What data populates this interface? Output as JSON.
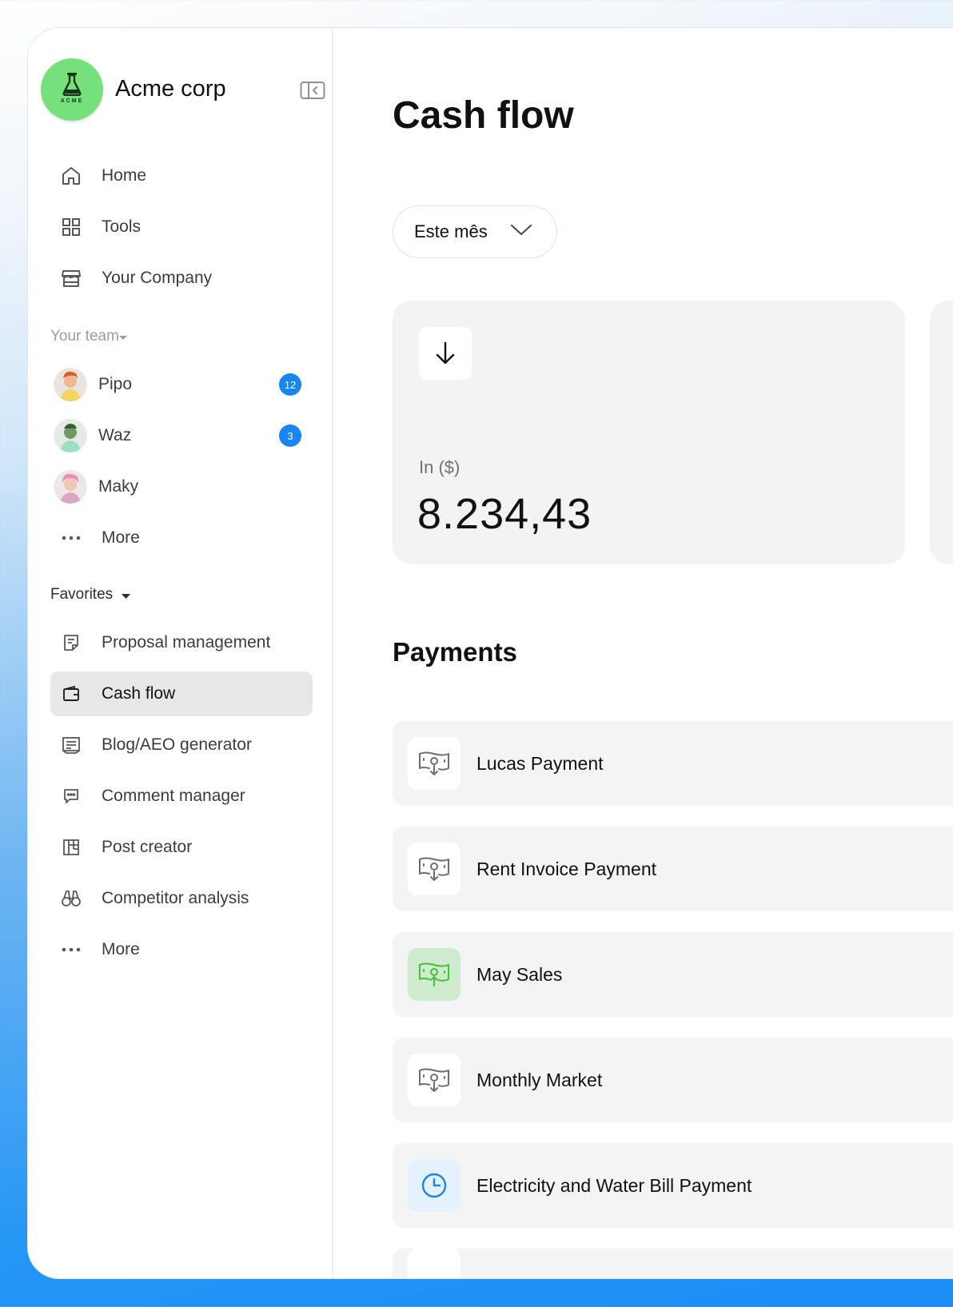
{
  "brand": {
    "name": "Acme corp",
    "logo_text": "ACME"
  },
  "nav": [
    {
      "label": "Home",
      "icon": "home-icon"
    },
    {
      "label": "Tools",
      "icon": "grid-icon"
    },
    {
      "label": "Your Company",
      "icon": "store-icon"
    }
  ],
  "team": {
    "label": "Your team",
    "members": [
      {
        "name": "Pipo",
        "badge": "12"
      },
      {
        "name": "Waz",
        "badge": "3"
      },
      {
        "name": "Maky",
        "badge": ""
      }
    ],
    "more_label": "More"
  },
  "favorites": {
    "label": "Favorites",
    "items": [
      {
        "label": "Proposal management",
        "icon": "document-icon"
      },
      {
        "label": "Cash flow",
        "icon": "wallet-icon",
        "active": true
      },
      {
        "label": "Blog/AEO generator",
        "icon": "article-icon"
      },
      {
        "label": "Comment manager",
        "icon": "comment-icon"
      },
      {
        "label": "Post creator",
        "icon": "layout-icon"
      },
      {
        "label": "Competitor analysis",
        "icon": "binoculars-icon"
      }
    ],
    "more_label": "More"
  },
  "main": {
    "title": "Cash flow",
    "period": {
      "selected": "Este mês"
    },
    "kpi": {
      "label": "In ($)",
      "value": "8.234,43"
    },
    "payments_title": "Payments",
    "payments": [
      {
        "name": "Lucas Payment",
        "icon": "money-in-icon",
        "style": "default"
      },
      {
        "name": "Rent Invoice Payment",
        "icon": "money-in-icon",
        "style": "default"
      },
      {
        "name": "May Sales",
        "icon": "money-out-icon",
        "style": "green"
      },
      {
        "name": "Monthly Market",
        "icon": "money-in-icon",
        "style": "default"
      },
      {
        "name": "Electricity and Water Bill Payment",
        "icon": "clock-icon",
        "style": "blue"
      }
    ]
  },
  "colors": {
    "accent": "#1786f0",
    "brand_green": "#76e07b",
    "card_bg": "#f2f3f2",
    "active_nav": "#e7e7e7"
  }
}
